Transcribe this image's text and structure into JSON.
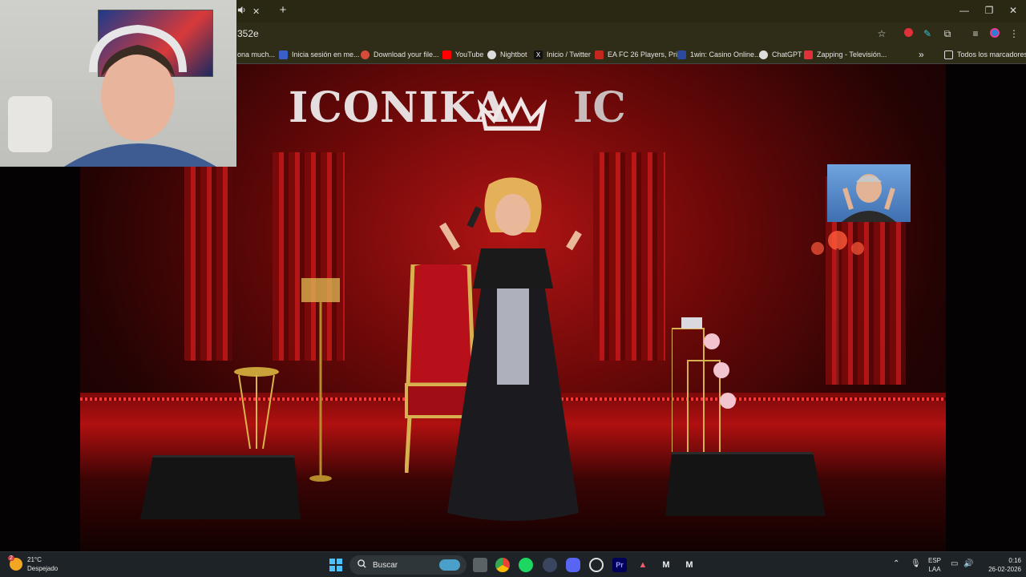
{
  "browser": {
    "tab_audio_icon": "speaker-icon",
    "tab_close": "✕",
    "new_tab": "+",
    "window_controls": {
      "minimize": "—",
      "restore": "❐",
      "close": "✕"
    },
    "address_fragment": "352e",
    "bookmarks": [
      {
        "label": "ona much...",
        "color": "#2f2d18"
      },
      {
        "label": "Inicia sesión en me...",
        "color": "#3b5fc8"
      },
      {
        "label": "Download your file...",
        "color": "#d84b3b"
      },
      {
        "label": "YouTube",
        "color": "#ff0000"
      },
      {
        "label": "Nightbot",
        "color": "#dddddd"
      },
      {
        "label": "Inicio / Twitter",
        "color": "#111111"
      },
      {
        "label": "EA FC 26 Players, Pri...",
        "color": "#c4271d"
      },
      {
        "label": "1win: Casino Online...",
        "color": "#2a4aa0"
      },
      {
        "label": "ChatGPT",
        "color": "#dddddd"
      },
      {
        "label": "Zapping - Televisión...",
        "color": "#e0303a"
      }
    ],
    "bookmarks_overflow": "»",
    "all_bookmarks": "Todos los marcadores"
  },
  "stage": {
    "brand_text": "ICONIKA",
    "brand_text_partial": "IC"
  },
  "taskbar": {
    "weather_temp": "21°C",
    "weather_desc": "Despejado",
    "weather_badge": "2",
    "search_label": "Buscar",
    "lang_top": "ESP",
    "lang_bottom": "LAA",
    "time": "0:16",
    "date": "26-02-2026"
  },
  "colors": {
    "chrome_bg": "#2f2d18",
    "tab_bg": "#2a2813",
    "taskbar_bg": "#1d2326",
    "stage_red": "#b01414"
  }
}
